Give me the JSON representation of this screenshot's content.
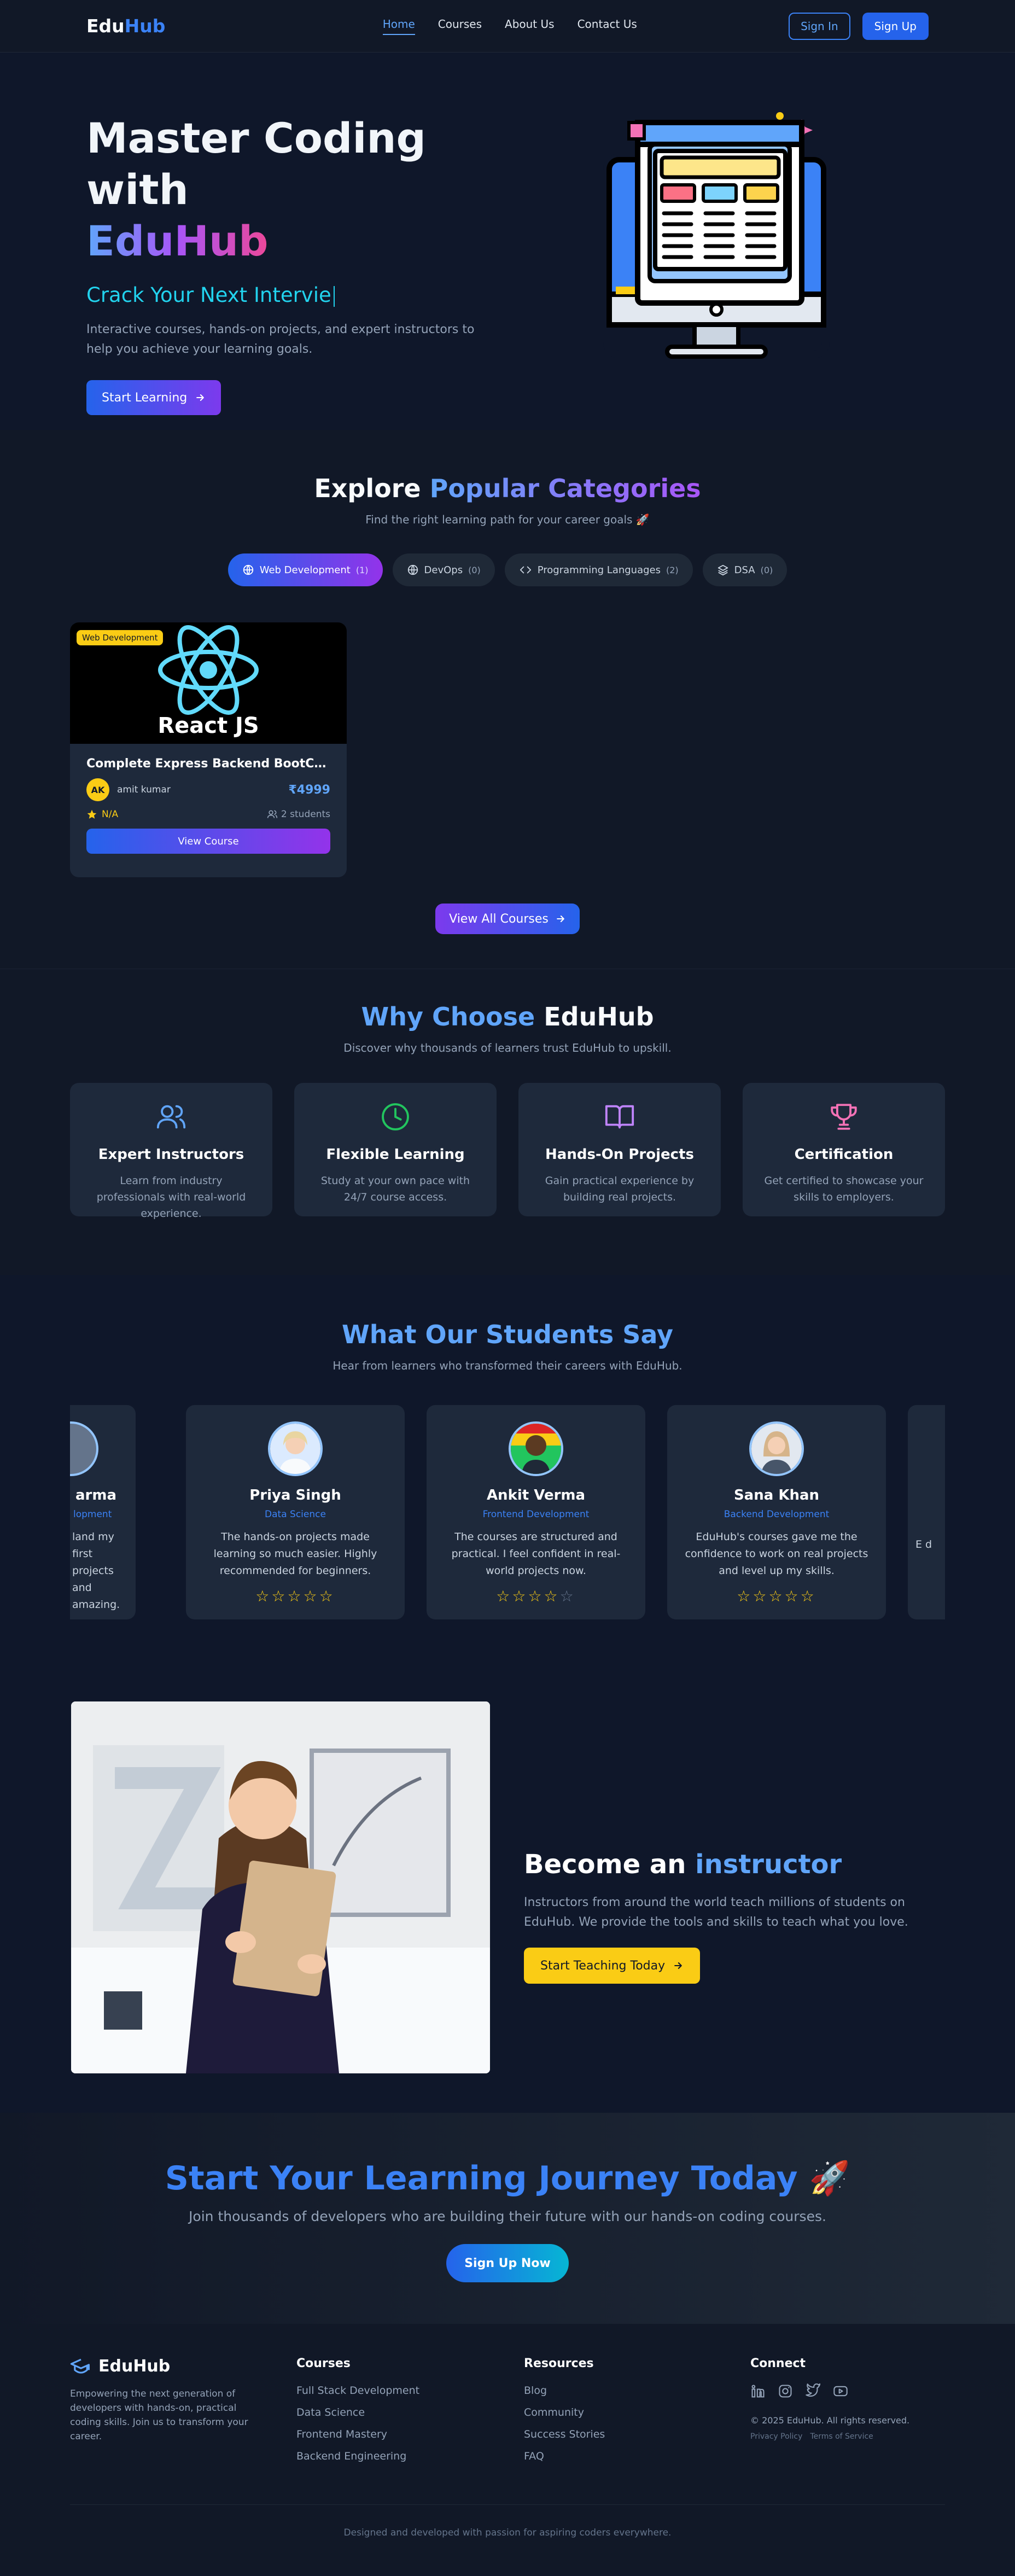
{
  "nav": {
    "logo_main": "Edu",
    "logo_accent": "Hub",
    "links": [
      "Home",
      "Courses",
      "About Us",
      "Contact Us"
    ],
    "signin": "Sign In",
    "signup": "Sign Up"
  },
  "hero": {
    "title_line1": "Master Coding with",
    "title_line2": "EduHub",
    "typed": "Crack Your Next Intervie",
    "description": "Interactive courses, hands-on projects, and expert instructors to help you achieve your learning goals.",
    "cta": "Start Learning"
  },
  "categories": {
    "title_part1": "Explore",
    "title_part2": "Popular Categories",
    "subtitle": "Find the right learning path for your career goals 🚀",
    "pills": [
      {
        "label": "Web Development",
        "count": "(1)"
      },
      {
        "label": "DevOps",
        "count": "(0)"
      },
      {
        "label": "Programming Languages",
        "count": "(2)"
      },
      {
        "label": "DSA",
        "count": "(0)"
      }
    ],
    "course": {
      "tag": "Web Development",
      "thumb_title": "React JS",
      "title": "Complete Express Backend BootCamp B...",
      "author_initials": "AK",
      "author": "amit kumar",
      "price": "₹4999",
      "rating": "N/A",
      "students": "2 students",
      "button": "View Course"
    },
    "view_all": "View All Courses"
  },
  "why": {
    "title_part1": "Why Choose",
    "title_part2": "EduHub",
    "subtitle": "Discover why thousands of learners trust EduHub to upskill.",
    "features": [
      {
        "title": "Expert Instructors",
        "desc": "Learn from industry professionals with real-world experience.",
        "icon": "users-icon",
        "color": "#60a5fa"
      },
      {
        "title": "Flexible Learning",
        "desc": "Study at your own pace with 24/7 course access.",
        "icon": "clock-icon",
        "color": "#22c55e"
      },
      {
        "title": "Hands-On Projects",
        "desc": "Gain practical experience by building real projects.",
        "icon": "book-icon",
        "color": "#c084fc"
      },
      {
        "title": "Certification",
        "desc": "Get certified to showcase your skills to employers.",
        "icon": "trophy-icon",
        "color": "#f472b6"
      }
    ]
  },
  "testimonials": {
    "title": "What Our Students Say",
    "subtitle": "Hear from learners who transformed their careers with EduHub.",
    "items": [
      {
        "name": "arma",
        "role": "lopment",
        "quote": "land my first projects and amazing.",
        "stars": "☆☆☆",
        "off": ""
      },
      {
        "name": "Priya Singh",
        "role": "Data Science",
        "quote": "The hands-on projects made learning so much easier. Highly recommended for beginners.",
        "stars": "☆☆☆☆☆",
        "off": ""
      },
      {
        "name": "Ankit Verma",
        "role": "Frontend Development",
        "quote": "The courses are structured and practical. I feel confident in real-world projects now.",
        "stars": "☆☆☆☆",
        "off": "☆"
      },
      {
        "name": "Sana Khan",
        "role": "Backend Development",
        "quote": "EduHub's courses gave me the confidence to work on real projects and level up my skills.",
        "stars": "☆☆☆☆☆",
        "off": ""
      },
      {
        "name": "",
        "role": "",
        "quote": "E d",
        "stars": "",
        "off": ""
      }
    ]
  },
  "instructor": {
    "title_part1": "Become an",
    "title_part2": "instructor",
    "desc": "Instructors from around the world teach millions of students on EduHub. We provide the tools and skills to teach what you love.",
    "cta": "Start Teaching Today"
  },
  "cta": {
    "title": "Start Your Learning Journey Today 🚀",
    "subtitle": "Join thousands of developers who are building their future with our hands-on coding courses.",
    "button": "Sign Up Now"
  },
  "footer": {
    "logo": "EduHub",
    "desc": "Empowering the next generation of developers with hands-on, practical coding skills. Join us to transform your career.",
    "courses_title": "Courses",
    "courses": [
      "Full Stack Development",
      "Data Science",
      "Frontend Mastery",
      "Backend Engineering"
    ],
    "resources_title": "Resources",
    "resources": [
      "Blog",
      "Community",
      "Success Stories",
      "FAQ"
    ],
    "connect_title": "Connect",
    "copyright": "© 2025 EduHub. All rights reserved.",
    "privacy": "Privacy Policy",
    "terms": "Terms of Service",
    "bottom": "Designed and developed with passion for aspiring coders everywhere."
  }
}
